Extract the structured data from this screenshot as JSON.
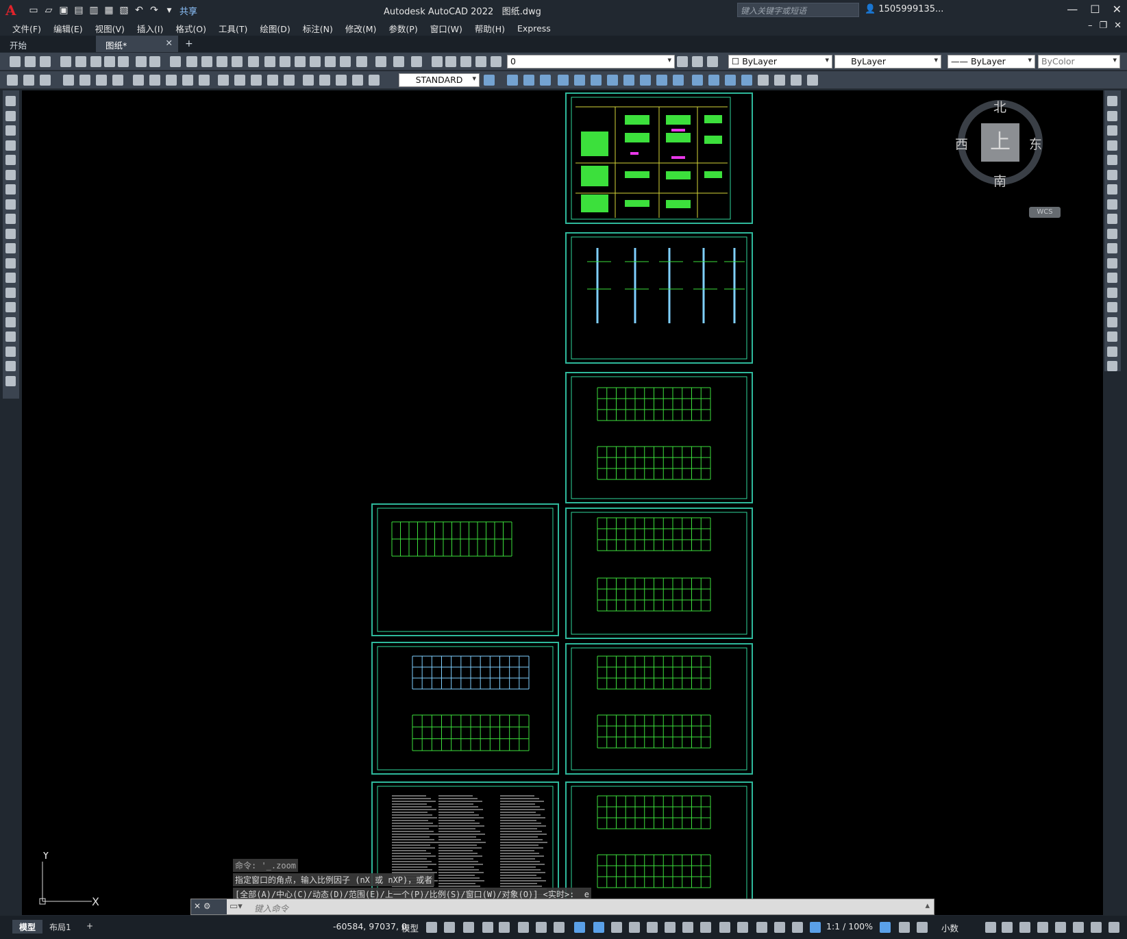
{
  "app": {
    "title": "Autodesk AutoCAD 2022",
    "file": "图纸.dwg",
    "share_label": "共享",
    "search_placeholder": "键入关键字或短语",
    "user": "1505999135...",
    "help": "?"
  },
  "menus": [
    "文件(F)",
    "编辑(E)",
    "视图(V)",
    "插入(I)",
    "格式(O)",
    "工具(T)",
    "绘图(D)",
    "标注(N)",
    "修改(M)",
    "参数(P)",
    "窗口(W)",
    "帮助(H)",
    "Express"
  ],
  "tabs": [
    {
      "label": "开始"
    },
    {
      "label": "图纸*"
    }
  ],
  "toolbar": {
    "layer_value": "0",
    "color_value": "ByLayer",
    "linetype_value": "ByLayer",
    "lineweight_value": "ByLayer",
    "plotstyle_value": "ByColor",
    "textstyle_value": "STANDARD"
  },
  "viewcube": {
    "north": "北",
    "south": "南",
    "east": "东",
    "west": "西",
    "face": "上",
    "wcs": "WCS"
  },
  "ucs": {
    "x": "X",
    "y": "Y"
  },
  "command": {
    "history": [
      "命令: '_.zoom",
      "指定窗口的角点，输入比例因子 (nX 或 nXP)，或者",
      "[全部(A)/中心(C)/动态(D)/范围(E)/上一个(P)/比例(S)/窗口(W)/对象(O)] <实时>: _e"
    ],
    "placeholder": "键入命令"
  },
  "status": {
    "layout_tabs": [
      "模型",
      "布局1"
    ],
    "coords": "-60584, 97037, 0",
    "space": "模型",
    "scale": "1:1 / 100%",
    "units": "小数"
  },
  "colors": {
    "accent": "#2fb99c",
    "canvas": "#000000",
    "ui": "#3b4450"
  }
}
